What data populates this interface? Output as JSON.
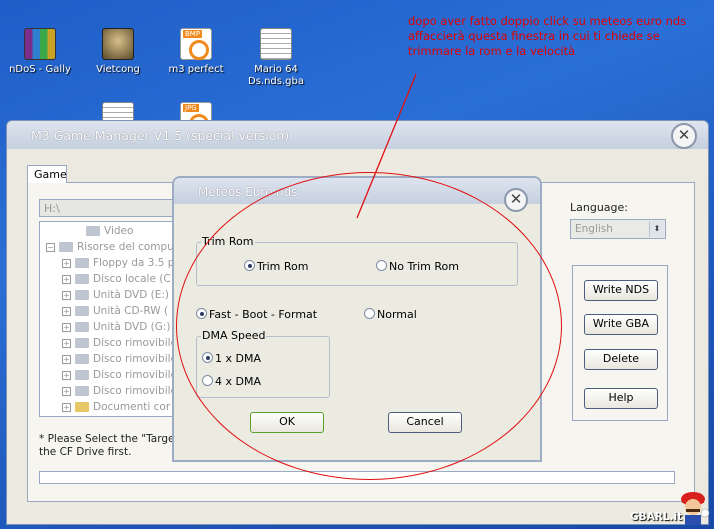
{
  "desktop": {
    "icons": [
      {
        "label": "nDoS - Gally",
        "icon": "winrar-icon"
      },
      {
        "label": "Vietcong",
        "icon": "game-shortcut-icon"
      },
      {
        "label": "m3 perfect",
        "icon": "bmp-image-icon",
        "tag": "BMP"
      },
      {
        "label": "Mario 64 Ds.nds.gba",
        "icon": "document-icon"
      },
      {
        "label": "",
        "icon": "document-icon"
      },
      {
        "label": "",
        "icon": "jpg-image-icon",
        "tag": "JPG"
      }
    ]
  },
  "annotation": "dopo aver fatto doppio click su meteos euro nds affaccierà questa finestra in cui ti chiede se trimmare la rom e la velocità",
  "main_window": {
    "title": "M3 Game Manager V1.5 (special version)",
    "close_label": "✕",
    "tab_label": "Game",
    "drive_value": "H:\\",
    "tree": [
      {
        "label": "Video",
        "indent": 2,
        "pm": "",
        "icon": "video"
      },
      {
        "label": "Risorse del compu",
        "indent": 0,
        "pm": "−",
        "icon": "computer"
      },
      {
        "label": "Floppy da 3.5 p",
        "indent": 1,
        "pm": "+",
        "icon": "drive"
      },
      {
        "label": "Disco locale (C",
        "indent": 1,
        "pm": "+",
        "icon": "drive"
      },
      {
        "label": "Unità DVD (E:)",
        "indent": 1,
        "pm": "+",
        "icon": "drive"
      },
      {
        "label": "Unità CD-RW (",
        "indent": 1,
        "pm": "+",
        "icon": "drive"
      },
      {
        "label": "Unità DVD (G:)",
        "indent": 1,
        "pm": "+",
        "icon": "drive"
      },
      {
        "label": "Disco rimovibile",
        "indent": 1,
        "pm": "+",
        "icon": "drive"
      },
      {
        "label": "Disco rimovibile",
        "indent": 1,
        "pm": "+",
        "icon": "drive"
      },
      {
        "label": "Disco rimovibile",
        "indent": 1,
        "pm": "+",
        "icon": "drive"
      },
      {
        "label": "Disco rimovibile",
        "indent": 1,
        "pm": "+",
        "icon": "drive"
      },
      {
        "label": "Documenti cor",
        "indent": 1,
        "pm": "+",
        "icon": "folder"
      }
    ],
    "hint": "* Please Select the \"Target the CF Drive first.",
    "language_label": "Language:",
    "language_value": "English",
    "buttons": {
      "write_nds": "Write NDS",
      "write_gba": "Write GBA",
      "delete": "Delete",
      "help": "Help"
    }
  },
  "dialog": {
    "title": "Meteos Euro.nds",
    "close_label": "✕",
    "trim_group_label": "Trim Rom",
    "trim_options": [
      {
        "label": "Trim Rom",
        "selected": true
      },
      {
        "label": "No Trim Rom",
        "selected": false
      }
    ],
    "boot_options": [
      {
        "label": "Fast - Boot - Format",
        "selected": true
      },
      {
        "label": "Normal",
        "selected": false
      }
    ],
    "dma_group_label": "DMA Speed",
    "dma_options": [
      {
        "label": "1 x DMA",
        "selected": true
      },
      {
        "label": "4 x DMA",
        "selected": false
      }
    ],
    "ok_label": "OK",
    "cancel_label": "Cancel"
  },
  "watermark": "GBARL.it",
  "colors": {
    "annotation": "#e00000",
    "desktop_blue": "#2a6fd6",
    "window_face": "#eceae0",
    "ok_border": "#5aa02c"
  }
}
